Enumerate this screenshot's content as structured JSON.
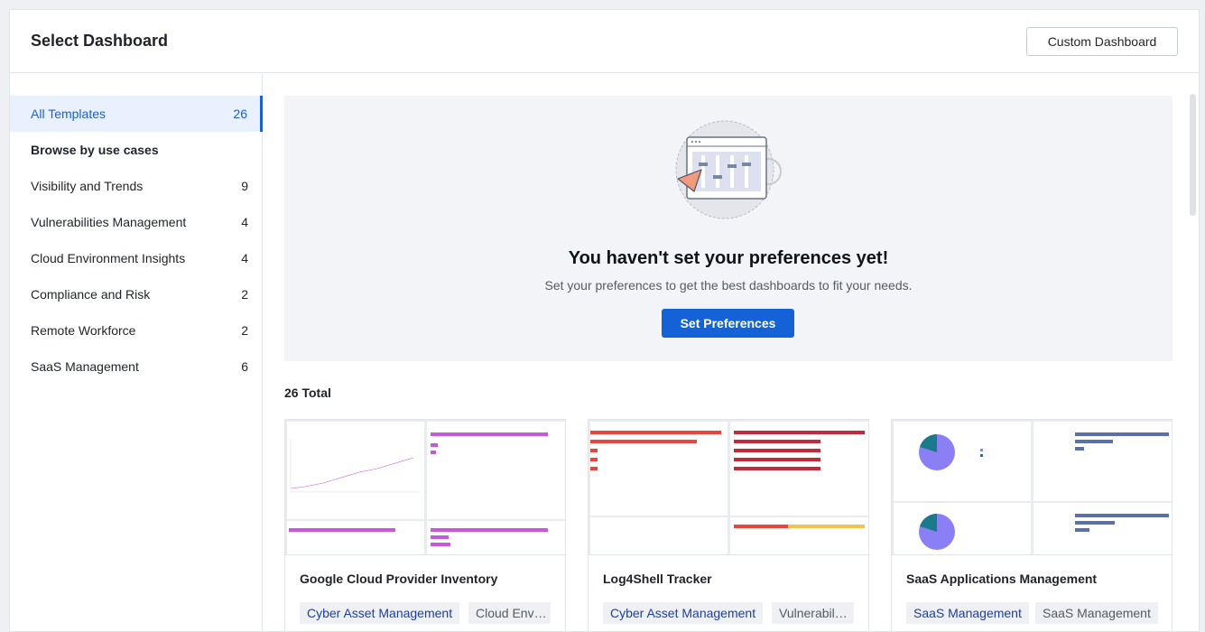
{
  "header": {
    "title": "Select Dashboard",
    "custom_button": "Custom Dashboard"
  },
  "sidebar": {
    "all_templates": {
      "label": "All Templates",
      "count": "26"
    },
    "heading": "Browse by use cases",
    "items": [
      {
        "label": "Visibility and Trends",
        "count": "9"
      },
      {
        "label": "Vulnerabilities Management",
        "count": "4"
      },
      {
        "label": "Cloud Environment Insights",
        "count": "4"
      },
      {
        "label": "Compliance and Risk",
        "count": "2"
      },
      {
        "label": "Remote Workforce",
        "count": "2"
      },
      {
        "label": "SaaS Management",
        "count": "6"
      }
    ]
  },
  "banner": {
    "title": "You haven't set your preferences yet!",
    "subtitle": "Set your preferences to get the best dashboards to fit your needs.",
    "button": "Set Preferences"
  },
  "total_label": "26 Total",
  "cards": [
    {
      "title": "Google Cloud Provider Inventory",
      "tags": [
        "Cyber Asset Management",
        "Cloud Env…"
      ]
    },
    {
      "title": "Log4Shell Tracker",
      "tags": [
        "Cyber Asset Management",
        "Vulnerabil…"
      ]
    },
    {
      "title": "SaaS Applications Management",
      "tags": [
        "SaaS Management",
        "SaaS Management"
      ]
    }
  ],
  "colors": {
    "accent": "#1462d8",
    "active_bg": "#e8f1fd",
    "purple_bar": "#c45ad8",
    "red_bar": "#e8453c",
    "dark_red_bar": "#c02a3c",
    "blue_bar": "#5b6fa8",
    "pie_purple": "#8b7ff5",
    "pie_teal": "#1a7a8a"
  }
}
